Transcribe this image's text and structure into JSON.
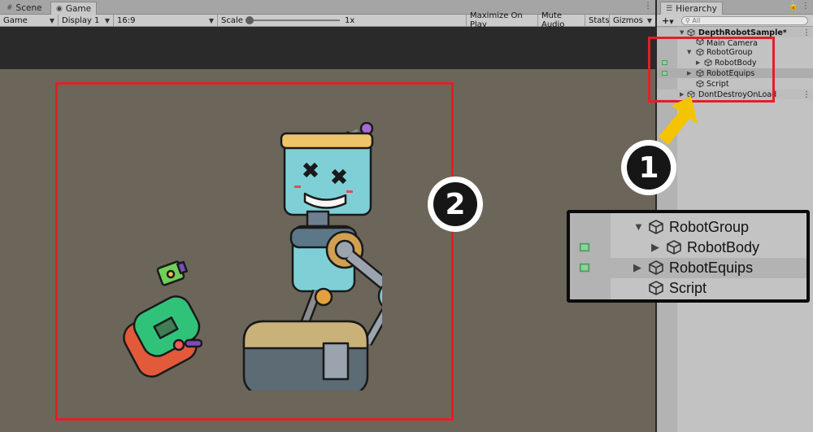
{
  "tabs": {
    "scene": "Scene",
    "game": "Game",
    "hierarchy": "Hierarchy"
  },
  "game_toolbar": {
    "view": "Game",
    "display": "Display 1",
    "aspect": "16:9",
    "scale_label": "Scale",
    "scale_value": "1x",
    "maximize": "Maximize On Play",
    "mute": "Mute Audio",
    "stats": "Stats",
    "gizmos": "Gizmos"
  },
  "hierarchy": {
    "add": "+",
    "search_placeholder": "All",
    "scene_name": "DepthRobotSample*",
    "items": [
      "Main Camera",
      "RobotGroup",
      "RobotBody",
      "RobotEquips",
      "Script",
      "DontDestroyOnLoad"
    ]
  },
  "callouts": {
    "one": "1",
    "two": "2"
  },
  "zoom": {
    "items": [
      "RobotGroup",
      "RobotBody",
      "RobotEquips",
      "Script"
    ]
  },
  "colors": {
    "highlight": "#e41e26",
    "arrow": "#f5c400",
    "game_bg": "#6b6659"
  }
}
